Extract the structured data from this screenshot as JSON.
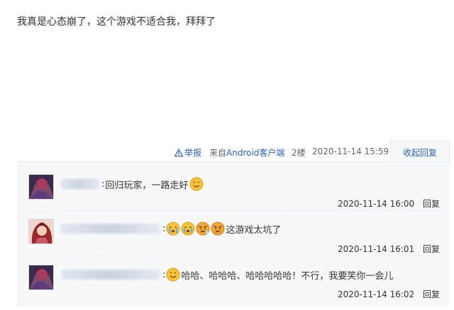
{
  "post": {
    "content": "我真是心态崩了，这个游戏不适合我，拜拜了"
  },
  "post_tail": {
    "report": "举报",
    "from_prefix": "来自",
    "from_client": "Android客户端",
    "floor": "2楼",
    "time": "2020-11-14 15:59",
    "fold_reply": "收起回复"
  },
  "replies": [
    {
      "text": "回归玩家，一路走好",
      "emojis": [
        "smile-emoji"
      ],
      "time": "2020-11-14 16:00",
      "reply": "回复"
    },
    {
      "text": "这游戏太坑了",
      "emojis": [
        "crying-emoji",
        "crying-emoji",
        "angry-emoji",
        "angry-emoji"
      ],
      "time": "2020-11-14 16:01",
      "reply": "回复"
    },
    {
      "text": "哈哈、哈哈哈、哈哈哈哈哈！不行，我要笑你一会儿",
      "emojis": [
        "smile-emoji"
      ],
      "time": "2020-11-14 16:02",
      "reply": "回复"
    }
  ],
  "colors": {
    "link": "#2d64b3",
    "reply_panel_bg": "#f7f8fa",
    "border": "#e5e8ee"
  }
}
